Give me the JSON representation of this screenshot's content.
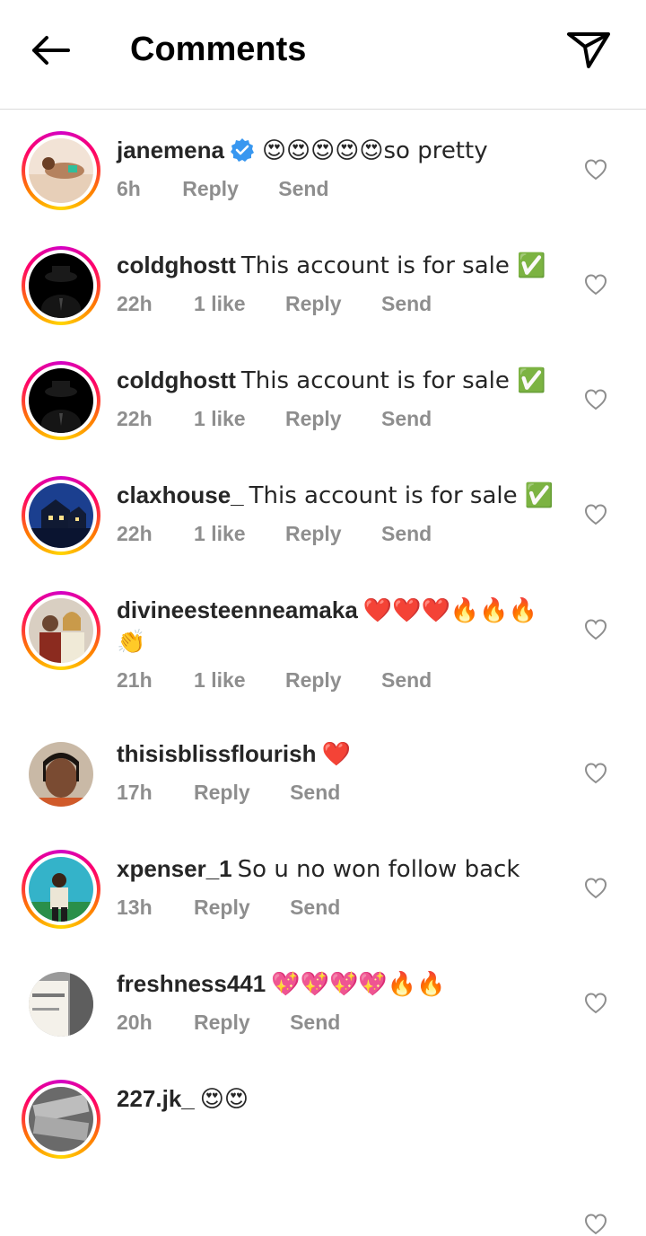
{
  "header": {
    "title": "Comments",
    "back_icon": "arrow-left-icon",
    "send_icon": "paper-plane-icon"
  },
  "comments": [
    {
      "username": "janemena",
      "verified": true,
      "text": "😍😍😍😍😍so pretty",
      "time": "6h",
      "likes": "",
      "reply": "Reply",
      "send": "Send",
      "ring": true
    },
    {
      "username": "coldghostt",
      "verified": false,
      "text": "This account is for sale ✅",
      "time": "22h",
      "likes": "1 like",
      "reply": "Reply",
      "send": "Send",
      "ring": true
    },
    {
      "username": "coldghostt",
      "verified": false,
      "text": "This account is for sale ✅",
      "time": "22h",
      "likes": "1 like",
      "reply": "Reply",
      "send": "Send",
      "ring": true
    },
    {
      "username": "claxhouse_",
      "verified": false,
      "text": "This account is for sale ✅",
      "time": "22h",
      "likes": "1 like",
      "reply": "Reply",
      "send": "Send",
      "ring": true
    },
    {
      "username": "divineesteenneamaka",
      "verified": false,
      "text": "❤️❤️❤️🔥🔥🔥👏",
      "time": "21h",
      "likes": "1 like",
      "reply": "Reply",
      "send": "Send",
      "ring": true
    },
    {
      "username": "thisisblissflourish",
      "verified": false,
      "text": "❤️",
      "time": "17h",
      "likes": "",
      "reply": "Reply",
      "send": "Send",
      "ring": false
    },
    {
      "username": "xpenser_1",
      "verified": false,
      "text": "So u no won follow back",
      "time": "13h",
      "likes": "",
      "reply": "Reply",
      "send": "Send",
      "ring": true
    },
    {
      "username": "freshness441",
      "verified": false,
      "text": "💖💖💖💖🔥🔥",
      "time": "20h",
      "likes": "",
      "reply": "Reply",
      "send": "Send",
      "ring": false
    },
    {
      "username": "227.jk_",
      "verified": false,
      "text": "😍😍",
      "time": "",
      "likes": "",
      "reply": "",
      "send": "",
      "ring": true
    }
  ],
  "colors": {
    "meta": "#8e8e8e",
    "verified_blue": "#3897f0",
    "divider": "#dbdbdb"
  }
}
